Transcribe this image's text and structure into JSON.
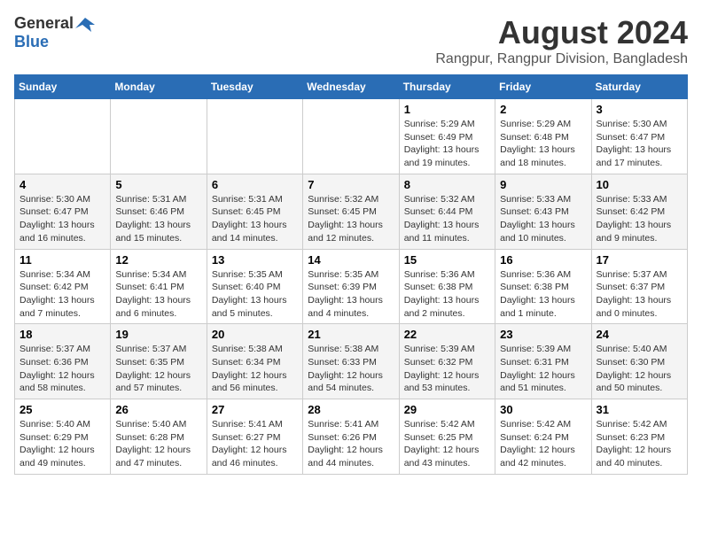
{
  "logo": {
    "general": "General",
    "blue": "Blue"
  },
  "title": "August 2024",
  "subtitle": "Rangpur, Rangpur Division, Bangladesh",
  "days_of_week": [
    "Sunday",
    "Monday",
    "Tuesday",
    "Wednesday",
    "Thursday",
    "Friday",
    "Saturday"
  ],
  "weeks": [
    [
      {
        "day": "",
        "info": ""
      },
      {
        "day": "",
        "info": ""
      },
      {
        "day": "",
        "info": ""
      },
      {
        "day": "",
        "info": ""
      },
      {
        "day": "1",
        "info": "Sunrise: 5:29 AM\nSunset: 6:49 PM\nDaylight: 13 hours\nand 19 minutes."
      },
      {
        "day": "2",
        "info": "Sunrise: 5:29 AM\nSunset: 6:48 PM\nDaylight: 13 hours\nand 18 minutes."
      },
      {
        "day": "3",
        "info": "Sunrise: 5:30 AM\nSunset: 6:47 PM\nDaylight: 13 hours\nand 17 minutes."
      }
    ],
    [
      {
        "day": "4",
        "info": "Sunrise: 5:30 AM\nSunset: 6:47 PM\nDaylight: 13 hours\nand 16 minutes."
      },
      {
        "day": "5",
        "info": "Sunrise: 5:31 AM\nSunset: 6:46 PM\nDaylight: 13 hours\nand 15 minutes."
      },
      {
        "day": "6",
        "info": "Sunrise: 5:31 AM\nSunset: 6:45 PM\nDaylight: 13 hours\nand 14 minutes."
      },
      {
        "day": "7",
        "info": "Sunrise: 5:32 AM\nSunset: 6:45 PM\nDaylight: 13 hours\nand 12 minutes."
      },
      {
        "day": "8",
        "info": "Sunrise: 5:32 AM\nSunset: 6:44 PM\nDaylight: 13 hours\nand 11 minutes."
      },
      {
        "day": "9",
        "info": "Sunrise: 5:33 AM\nSunset: 6:43 PM\nDaylight: 13 hours\nand 10 minutes."
      },
      {
        "day": "10",
        "info": "Sunrise: 5:33 AM\nSunset: 6:42 PM\nDaylight: 13 hours\nand 9 minutes."
      }
    ],
    [
      {
        "day": "11",
        "info": "Sunrise: 5:34 AM\nSunset: 6:42 PM\nDaylight: 13 hours\nand 7 minutes."
      },
      {
        "day": "12",
        "info": "Sunrise: 5:34 AM\nSunset: 6:41 PM\nDaylight: 13 hours\nand 6 minutes."
      },
      {
        "day": "13",
        "info": "Sunrise: 5:35 AM\nSunset: 6:40 PM\nDaylight: 13 hours\nand 5 minutes."
      },
      {
        "day": "14",
        "info": "Sunrise: 5:35 AM\nSunset: 6:39 PM\nDaylight: 13 hours\nand 4 minutes."
      },
      {
        "day": "15",
        "info": "Sunrise: 5:36 AM\nSunset: 6:38 PM\nDaylight: 13 hours\nand 2 minutes."
      },
      {
        "day": "16",
        "info": "Sunrise: 5:36 AM\nSunset: 6:38 PM\nDaylight: 13 hours\nand 1 minute."
      },
      {
        "day": "17",
        "info": "Sunrise: 5:37 AM\nSunset: 6:37 PM\nDaylight: 13 hours\nand 0 minutes."
      }
    ],
    [
      {
        "day": "18",
        "info": "Sunrise: 5:37 AM\nSunset: 6:36 PM\nDaylight: 12 hours\nand 58 minutes."
      },
      {
        "day": "19",
        "info": "Sunrise: 5:37 AM\nSunset: 6:35 PM\nDaylight: 12 hours\nand 57 minutes."
      },
      {
        "day": "20",
        "info": "Sunrise: 5:38 AM\nSunset: 6:34 PM\nDaylight: 12 hours\nand 56 minutes."
      },
      {
        "day": "21",
        "info": "Sunrise: 5:38 AM\nSunset: 6:33 PM\nDaylight: 12 hours\nand 54 minutes."
      },
      {
        "day": "22",
        "info": "Sunrise: 5:39 AM\nSunset: 6:32 PM\nDaylight: 12 hours\nand 53 minutes."
      },
      {
        "day": "23",
        "info": "Sunrise: 5:39 AM\nSunset: 6:31 PM\nDaylight: 12 hours\nand 51 minutes."
      },
      {
        "day": "24",
        "info": "Sunrise: 5:40 AM\nSunset: 6:30 PM\nDaylight: 12 hours\nand 50 minutes."
      }
    ],
    [
      {
        "day": "25",
        "info": "Sunrise: 5:40 AM\nSunset: 6:29 PM\nDaylight: 12 hours\nand 49 minutes."
      },
      {
        "day": "26",
        "info": "Sunrise: 5:40 AM\nSunset: 6:28 PM\nDaylight: 12 hours\nand 47 minutes."
      },
      {
        "day": "27",
        "info": "Sunrise: 5:41 AM\nSunset: 6:27 PM\nDaylight: 12 hours\nand 46 minutes."
      },
      {
        "day": "28",
        "info": "Sunrise: 5:41 AM\nSunset: 6:26 PM\nDaylight: 12 hours\nand 44 minutes."
      },
      {
        "day": "29",
        "info": "Sunrise: 5:42 AM\nSunset: 6:25 PM\nDaylight: 12 hours\nand 43 minutes."
      },
      {
        "day": "30",
        "info": "Sunrise: 5:42 AM\nSunset: 6:24 PM\nDaylight: 12 hours\nand 42 minutes."
      },
      {
        "day": "31",
        "info": "Sunrise: 5:42 AM\nSunset: 6:23 PM\nDaylight: 12 hours\nand 40 minutes."
      }
    ]
  ]
}
